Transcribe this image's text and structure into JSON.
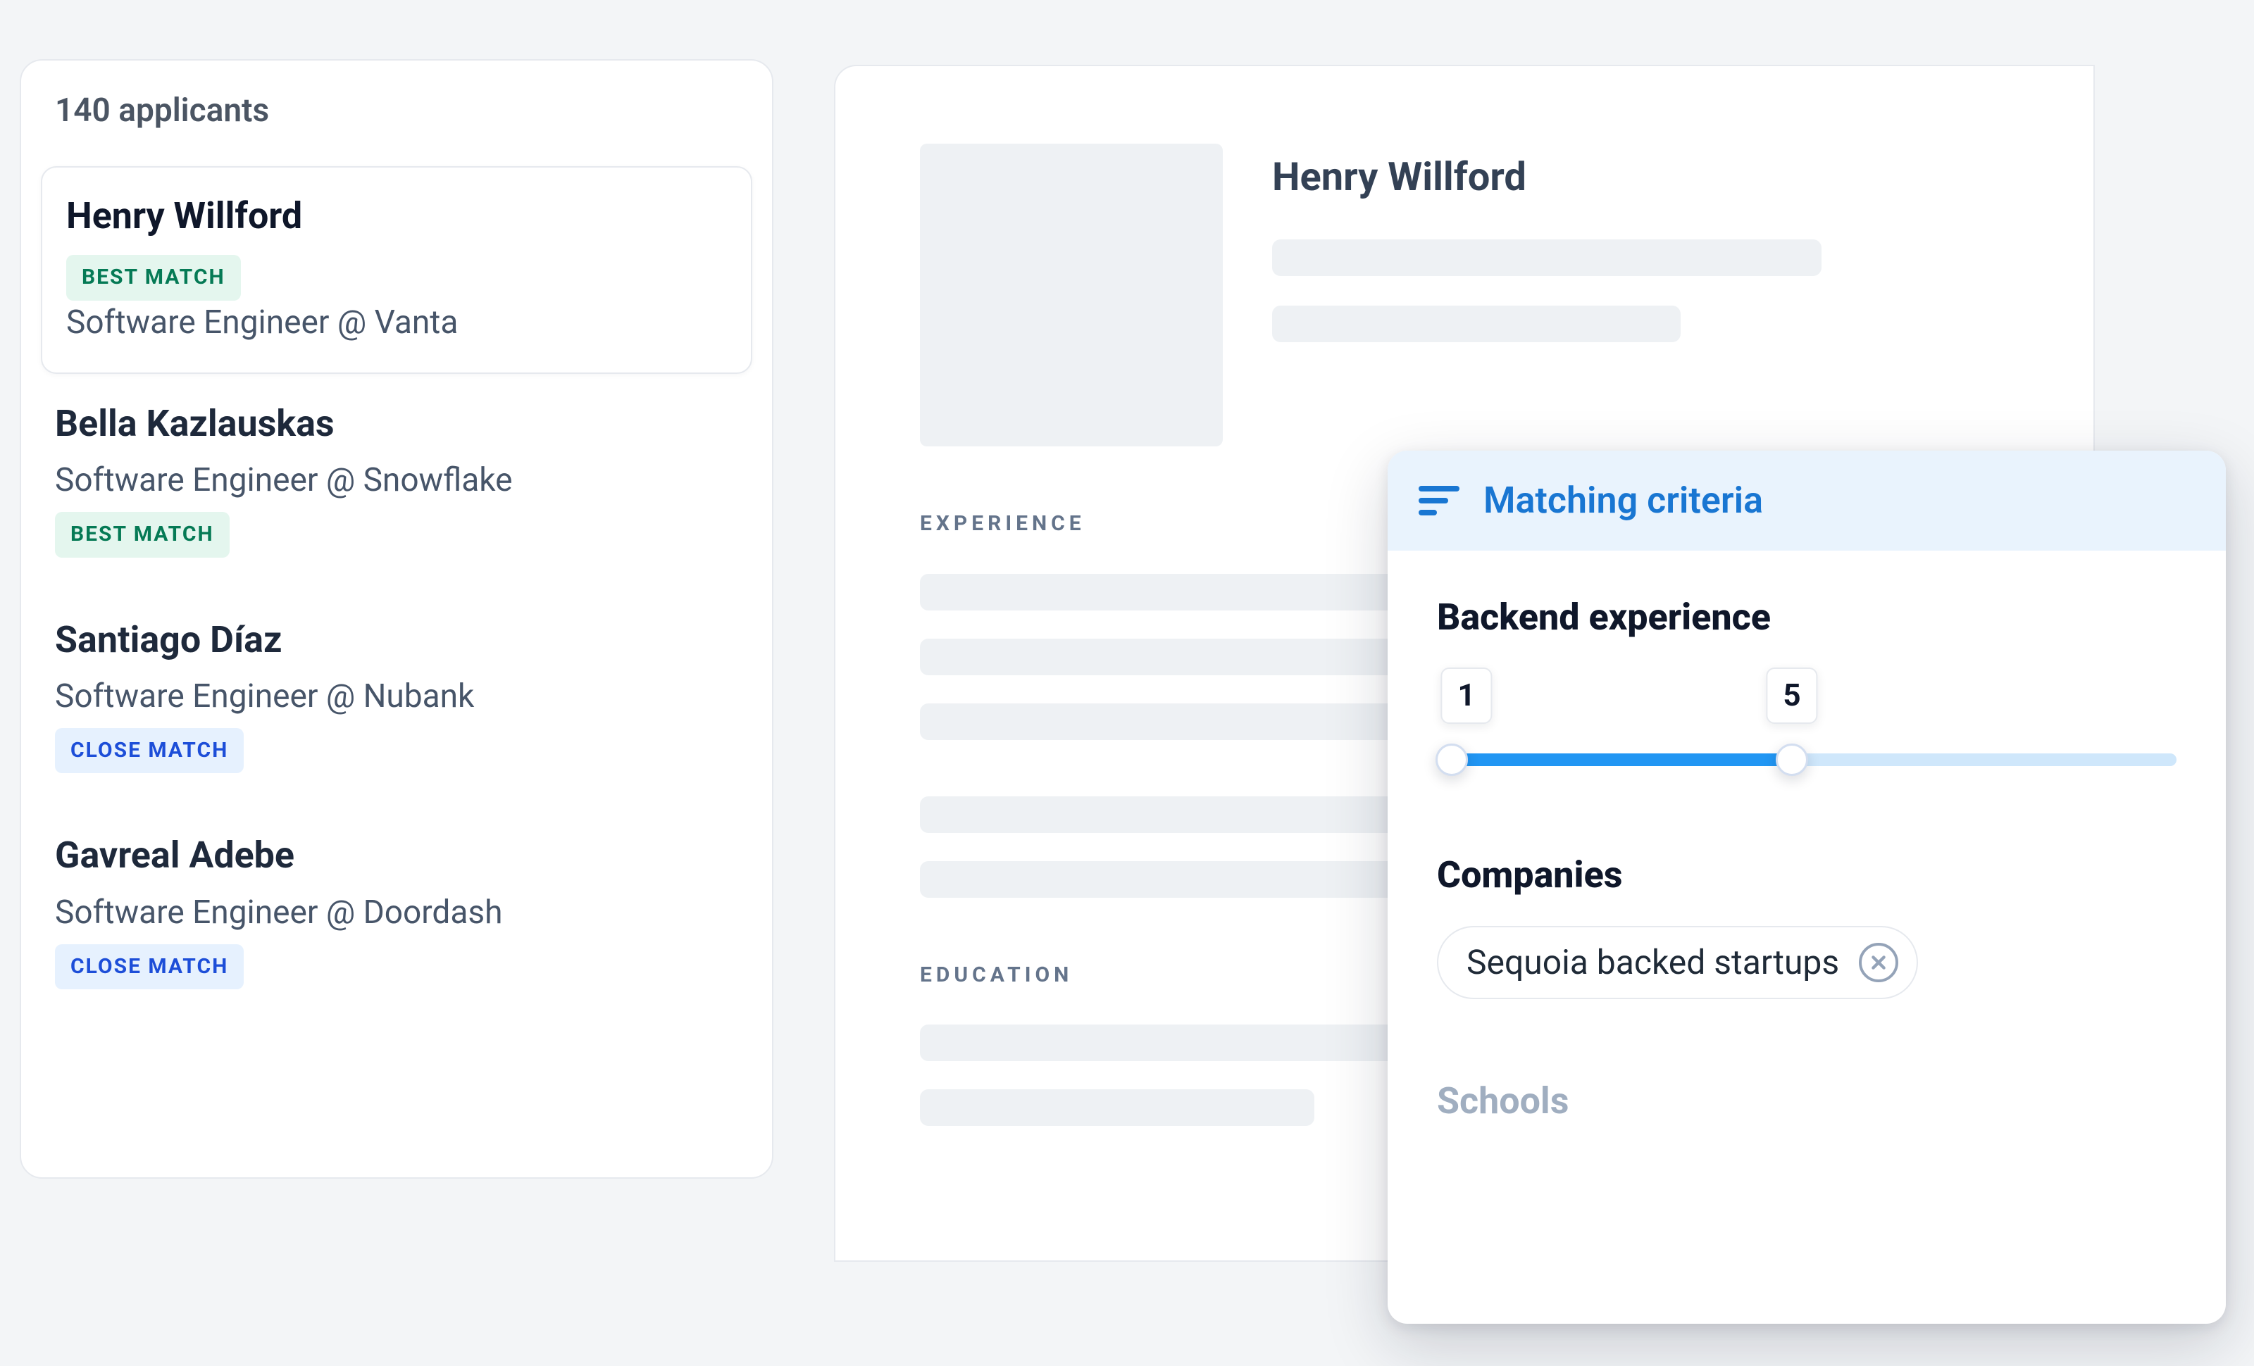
{
  "applicants": {
    "header": "140 applicants",
    "items": [
      {
        "name": "Henry Willford",
        "role": "Software Engineer @ Vanta",
        "match_label": "BEST MATCH",
        "match_variant": "best",
        "selected": true,
        "badge_before_role": true
      },
      {
        "name": "Bella Kazlauskas",
        "role": "Software Engineer @ Snowflake",
        "match_label": "BEST MATCH",
        "match_variant": "best",
        "selected": false,
        "badge_before_role": false
      },
      {
        "name": "Santiago Díaz",
        "role": "Software Engineer @ Nubank",
        "match_label": "CLOSE MATCH",
        "match_variant": "close",
        "selected": false,
        "badge_before_role": false
      },
      {
        "name": "Gavreal Adebe",
        "role": "Software Engineer @ Doordash",
        "match_label": "CLOSE MATCH",
        "match_variant": "close",
        "selected": false,
        "badge_before_role": false
      }
    ]
  },
  "detail": {
    "name": "Henry Willford",
    "sections": {
      "experience_label": "EXPERIENCE",
      "education_label": "EDUCATION"
    }
  },
  "criteria": {
    "title": "Matching criteria",
    "backend": {
      "title": "Backend experience",
      "min_label": "1",
      "max_label": "5",
      "range_min": 1,
      "range_max": 10,
      "value_low": 1,
      "value_high": 5
    },
    "companies": {
      "title": "Companies",
      "chips": [
        "Sequoia backed startups"
      ]
    },
    "schools": {
      "title": "Schools"
    }
  },
  "colors": {
    "accent": "#2196f3",
    "accent_text": "#1976d2",
    "best_bg": "#e4f6ee",
    "best_fg": "#057a55",
    "close_bg": "#e6f1fe",
    "close_fg": "#1d4ed8"
  }
}
